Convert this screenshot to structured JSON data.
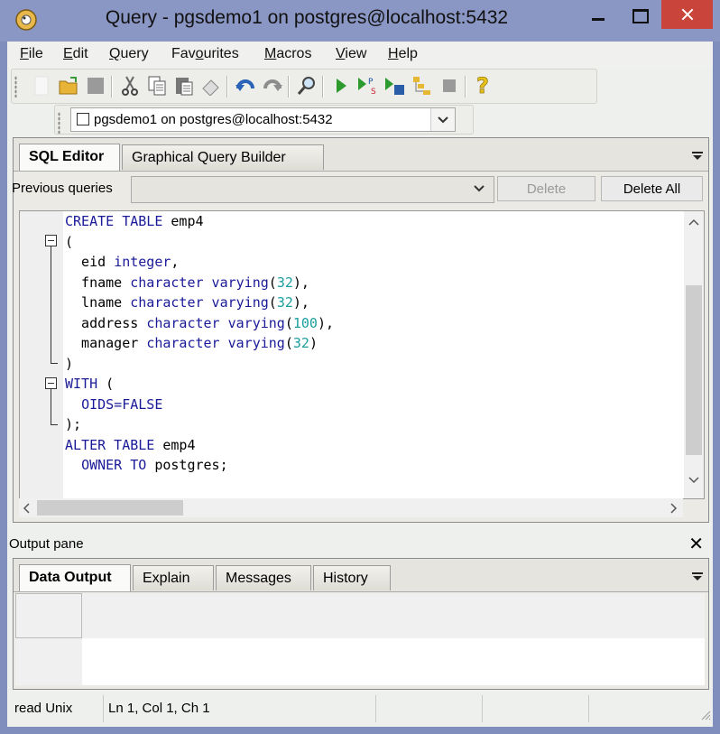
{
  "window": {
    "title": "Query - pgsdemo1 on postgres@localhost:5432"
  },
  "menu": {
    "items": [
      {
        "label": "File",
        "key": "F",
        "rest": "ile"
      },
      {
        "label": "Edit",
        "key": "E",
        "rest": "dit"
      },
      {
        "label": "Query",
        "key": "Q",
        "rest": "uery"
      },
      {
        "label": "Favourites",
        "pre": "Fav",
        "key": "o",
        "rest": "urites"
      },
      {
        "label": "Macros",
        "key": "M",
        "rest": "acros"
      },
      {
        "label": "View",
        "key": "V",
        "rest": "iew"
      },
      {
        "label": "Help",
        "key": "H",
        "rest": "elp"
      }
    ]
  },
  "toolbar": {
    "icons": [
      "new-file-icon",
      "open-folder-icon",
      "save-icon",
      "cut-icon",
      "copy-icon",
      "paste-icon",
      "clear-icon",
      "undo-icon",
      "redo-icon",
      "find-icon",
      "execute-icon",
      "explain-icon",
      "execute-to-file-icon",
      "explain-options-icon",
      "stop-icon",
      "help-icon"
    ]
  },
  "connection": {
    "label": "pgsdemo1 on postgres@localhost:5432"
  },
  "editor_tabs": {
    "sql_editor": "SQL Editor",
    "gqb": "Graphical Query Builder"
  },
  "previous_queries": {
    "label": "Previous queries",
    "value": "",
    "delete": "Delete",
    "delete_all": "Delete All"
  },
  "sql": {
    "lines": [
      "CREATE TABLE emp4",
      "(",
      "  eid integer,",
      "  fname character varying(32),",
      "  lname character varying(32),",
      "  address character varying(100),",
      "  manager character varying(32)",
      ")",
      "WITH (",
      "  OIDS=FALSE",
      ");",
      "ALTER TABLE emp4",
      "  OWNER TO postgres;"
    ]
  },
  "output": {
    "title": "Output pane",
    "tabs": [
      "Data Output",
      "Explain",
      "Messages",
      "History"
    ]
  },
  "status": {
    "mode": "read Unix",
    "position": "Ln 1, Col 1, Ch 1"
  }
}
